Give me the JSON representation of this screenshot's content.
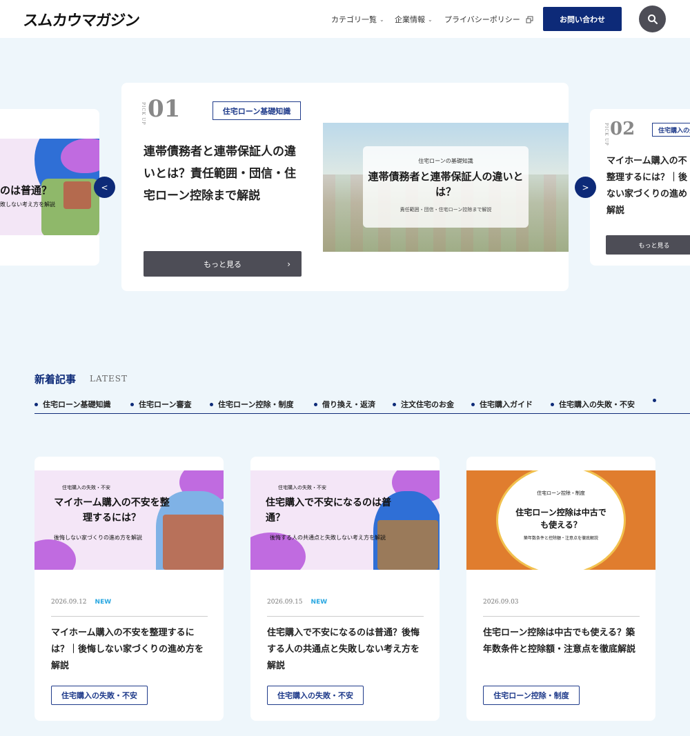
{
  "header": {
    "logo": "スムカウマガジン",
    "nav": [
      {
        "label": "カテゴリ一覧"
      },
      {
        "label": "企業情報"
      },
      {
        "label": "プライバシーポリシー"
      }
    ],
    "contact_label": "お問い合わせ"
  },
  "pickup": {
    "label": "PICK UP",
    "main": {
      "num": "01",
      "tag": "住宅ローン基礎知識",
      "title": "連帯債務者と連帯保証人の違いとは？責任範囲・団信・住宅ローン控除まで解説",
      "more": "もっと見る",
      "img_small": "住宅ローンの基礎知識",
      "img_title": "連帯債務者と連帯保証人の違いとは？",
      "img_sub": "責任範囲・団信・住宅ローン控除まで解説"
    },
    "prev": {
      "img_title": "のは普通？",
      "img_sub": "敗しない考え方を解説",
      "arrow": "<"
    },
    "next": {
      "num": "02",
      "tag": "住宅購入の失",
      "title_lines": [
        "マイホーム購入の不",
        "整理するには？｜後",
        "ない家づくりの進め",
        "解説"
      ],
      "more": "もっと見る",
      "arrow": ">"
    }
  },
  "latest": {
    "title": "新着記事",
    "title_en": "LATEST",
    "categories": [
      "住宅ローン基礎知識",
      "住宅ローン審査",
      "住宅ローン控除・制度",
      "借り換え・返済",
      "注文住宅のお金",
      "住宅購入ガイド",
      "住宅購入の失敗・不安"
    ],
    "posts": [
      {
        "img_small": "住宅購入の失敗・不安",
        "img_title": "マイホーム購入の不安を整理するには？",
        "img_sub": "後悔しない家づくりの進め方を解説",
        "date": "2026.09.12",
        "badge": "NEW",
        "title": "マイホーム購入の不安を整理するには？｜後悔しない家づくりの進め方を解説",
        "tag": "住宅購入の失敗・不安"
      },
      {
        "img_small": "住宅購入の失敗・不安",
        "img_title": "住宅購入で不安になるのは普通？",
        "img_sub": "後悔する人の共通点と失敗しない考え方を解説",
        "date": "2026.09.15",
        "badge": "NEW",
        "title": "住宅購入で不安になるのは普通？後悔する人の共通点と失敗しない考え方を解説",
        "tag": "住宅購入の失敗・不安"
      },
      {
        "img_small": "住宅ローン控除・制度",
        "img_title": "住宅ローン控除は中古でも使える？",
        "img_sub": "築年数条件と控除額・注意点を徹底解説",
        "date": "2026.09.03",
        "badge": "",
        "title": "住宅ローン控除は中古でも使える？築年数条件と控除額・注意点を徹底解説",
        "tag": "住宅ローン控除・制度"
      }
    ]
  },
  "colors": {
    "brand_navy": "#0d2a78",
    "button_gray": "#4d4d56",
    "page_bg": "#eef6fb",
    "new_badge": "#29a7e1"
  }
}
